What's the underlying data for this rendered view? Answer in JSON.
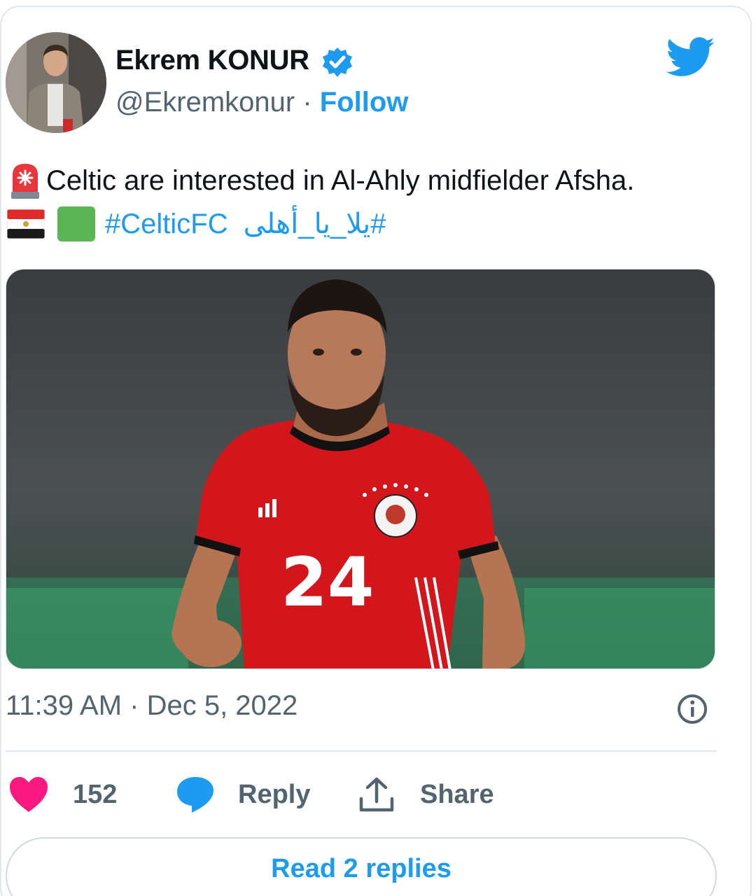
{
  "author": {
    "display_name": "Ekrem KONUR",
    "handle": "@Ekremkonur",
    "separator": " · ",
    "follow_label": "Follow"
  },
  "tweet": {
    "text_line1": "Celtic are interested in Al-Ahly midfielder Afsha.",
    "hashtag_en": "#CelticFC",
    "hashtag_ar": "#يلا_يا_أهلى",
    "emoji_icons": [
      "police-light-icon",
      "egypt-flag-icon",
      "green-square-icon"
    ]
  },
  "media": {
    "jersey_number": "24",
    "kit_color": "#d3161b"
  },
  "meta": {
    "timestamp": "11:39 AM · Dec 5, 2022"
  },
  "actions": {
    "likes_count": "152",
    "reply_label": "Reply",
    "share_label": "Share",
    "read_replies_label": "Read 2 replies"
  },
  "colors": {
    "accent": "#1d9bf0",
    "like": "#f91880",
    "secondary_text": "#536471"
  }
}
